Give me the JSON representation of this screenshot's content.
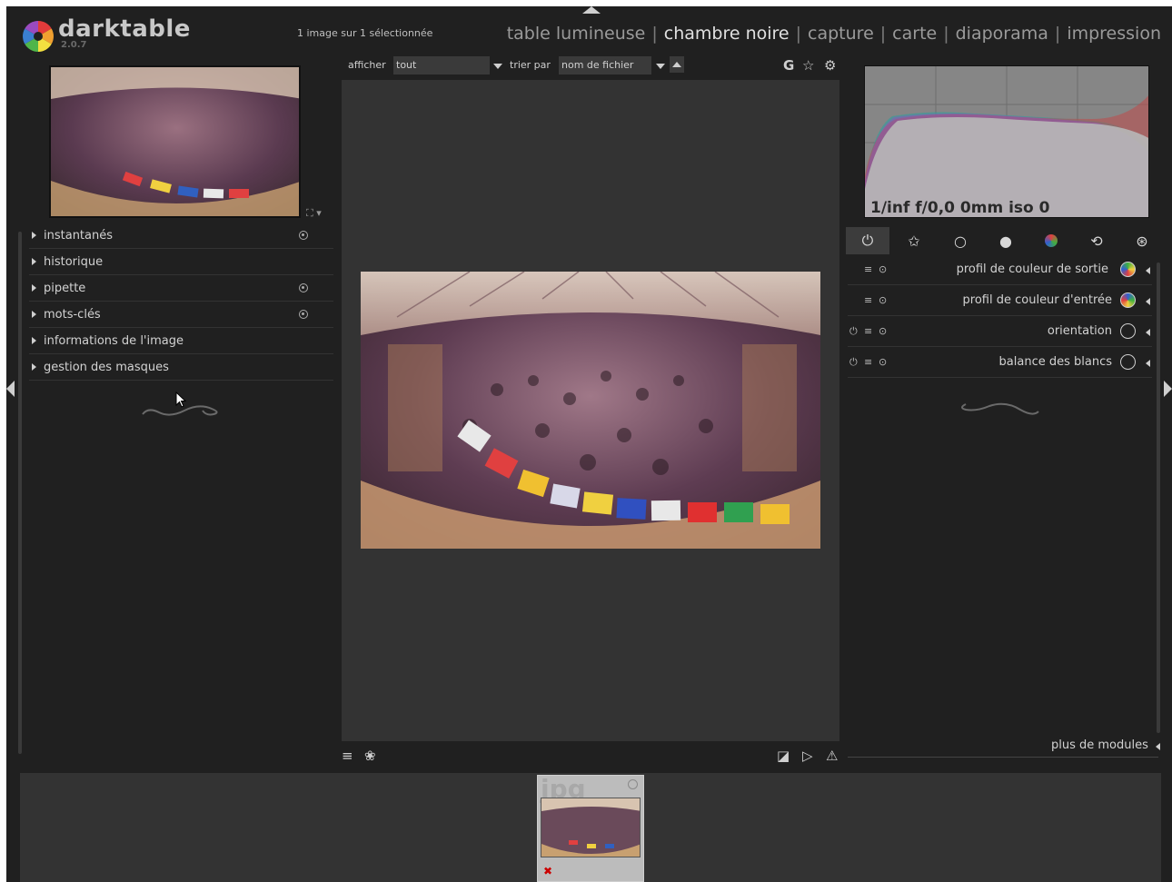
{
  "app": {
    "name": "darktable",
    "version": "2.0.7",
    "selection_status": "1 image sur 1 sélectionnée"
  },
  "views": [
    {
      "label": "table lumineuse",
      "active": false
    },
    {
      "label": "chambre noire",
      "active": true
    },
    {
      "label": "capture",
      "active": false
    },
    {
      "label": "carte",
      "active": false
    },
    {
      "label": "diaporama",
      "active": false
    },
    {
      "label": "impression",
      "active": false
    }
  ],
  "view_separator": "|",
  "filter_bar": {
    "show_label": "afficher",
    "show_value": "tout",
    "sort_label": "trier par",
    "sort_value": "nom de fichier",
    "grouping_icon": "G"
  },
  "left_panel": {
    "modules": [
      {
        "label": "instantanés",
        "has_presets": true
      },
      {
        "label": "historique",
        "has_presets": false
      },
      {
        "label": "pipette",
        "has_presets": true
      },
      {
        "label": "mots-clés",
        "has_presets": true
      },
      {
        "label": "informations de l'image",
        "has_presets": false
      },
      {
        "label": "gestion des masques",
        "has_presets": false
      }
    ]
  },
  "histogram": {
    "exif_info": "1/inf f/0,0 0mm iso 0"
  },
  "right_panel": {
    "groups": [
      "power-icon",
      "star-icon",
      "circle-icon",
      "sphere-icon",
      "color-icon",
      "rotate-icon",
      "effects-icon"
    ],
    "modules": [
      {
        "label": "profil de couleur de sortie",
        "icon": "color-profile-icon",
        "power": false
      },
      {
        "label": "profil de couleur d'entrée",
        "icon": "color-profile-icon",
        "power": false
      },
      {
        "label": "orientation",
        "icon": "orientation-icon",
        "power": true
      },
      {
        "label": "balance des blancs",
        "icon": "thermometer-icon",
        "power": true
      }
    ],
    "more_modules": "plus de modules"
  },
  "filmstrip": {
    "thumb_ext": "jpg"
  },
  "colors": {
    "background": "#202020",
    "center": "#333333",
    "text": "#d2d2d2"
  }
}
